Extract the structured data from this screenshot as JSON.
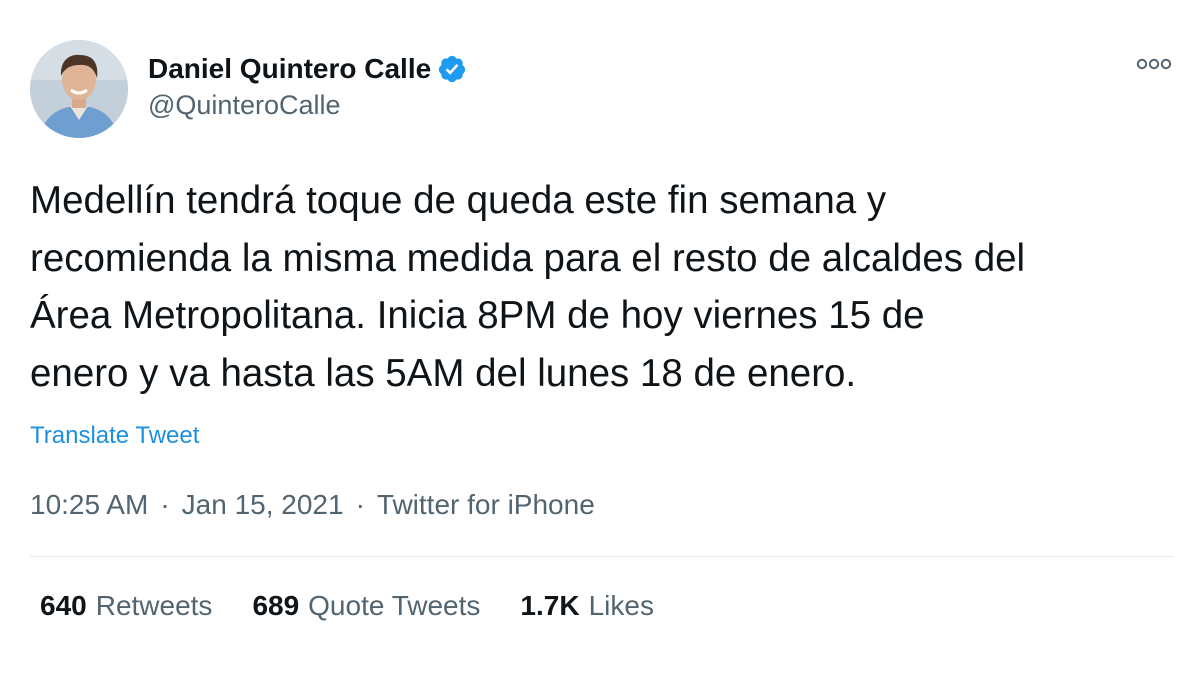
{
  "user": {
    "display_name": "Daniel Quintero Calle",
    "handle": "@QuinteroCalle",
    "verified": true
  },
  "tweet": {
    "lines": [
      "Medellín tendrá toque de queda este fin semana y",
      "recomienda la misma medida para el resto de alcaldes del",
      "Área Metropolitana. Inicia 8PM de hoy viernes 15 de",
      "enero y va hasta las 5AM del lunes 18 de enero."
    ],
    "translate_label": "Translate Tweet",
    "time": "10:25 AM",
    "date": "Jan 15, 2021",
    "source": "Twitter for iPhone",
    "separator": "·"
  },
  "stats": {
    "retweets": {
      "count": "640",
      "label": "Retweets"
    },
    "quote_tweets": {
      "count": "689",
      "label": "Quote Tweets"
    },
    "likes": {
      "count": "1.7K",
      "label": "Likes"
    }
  },
  "icons": {
    "verified": "verified-badge-icon",
    "more": "more-options-icon"
  },
  "colors": {
    "link": "#1d8fe0",
    "verified": "#1d9bf0",
    "secondary_text": "#536471",
    "primary_text": "#0f1419"
  }
}
